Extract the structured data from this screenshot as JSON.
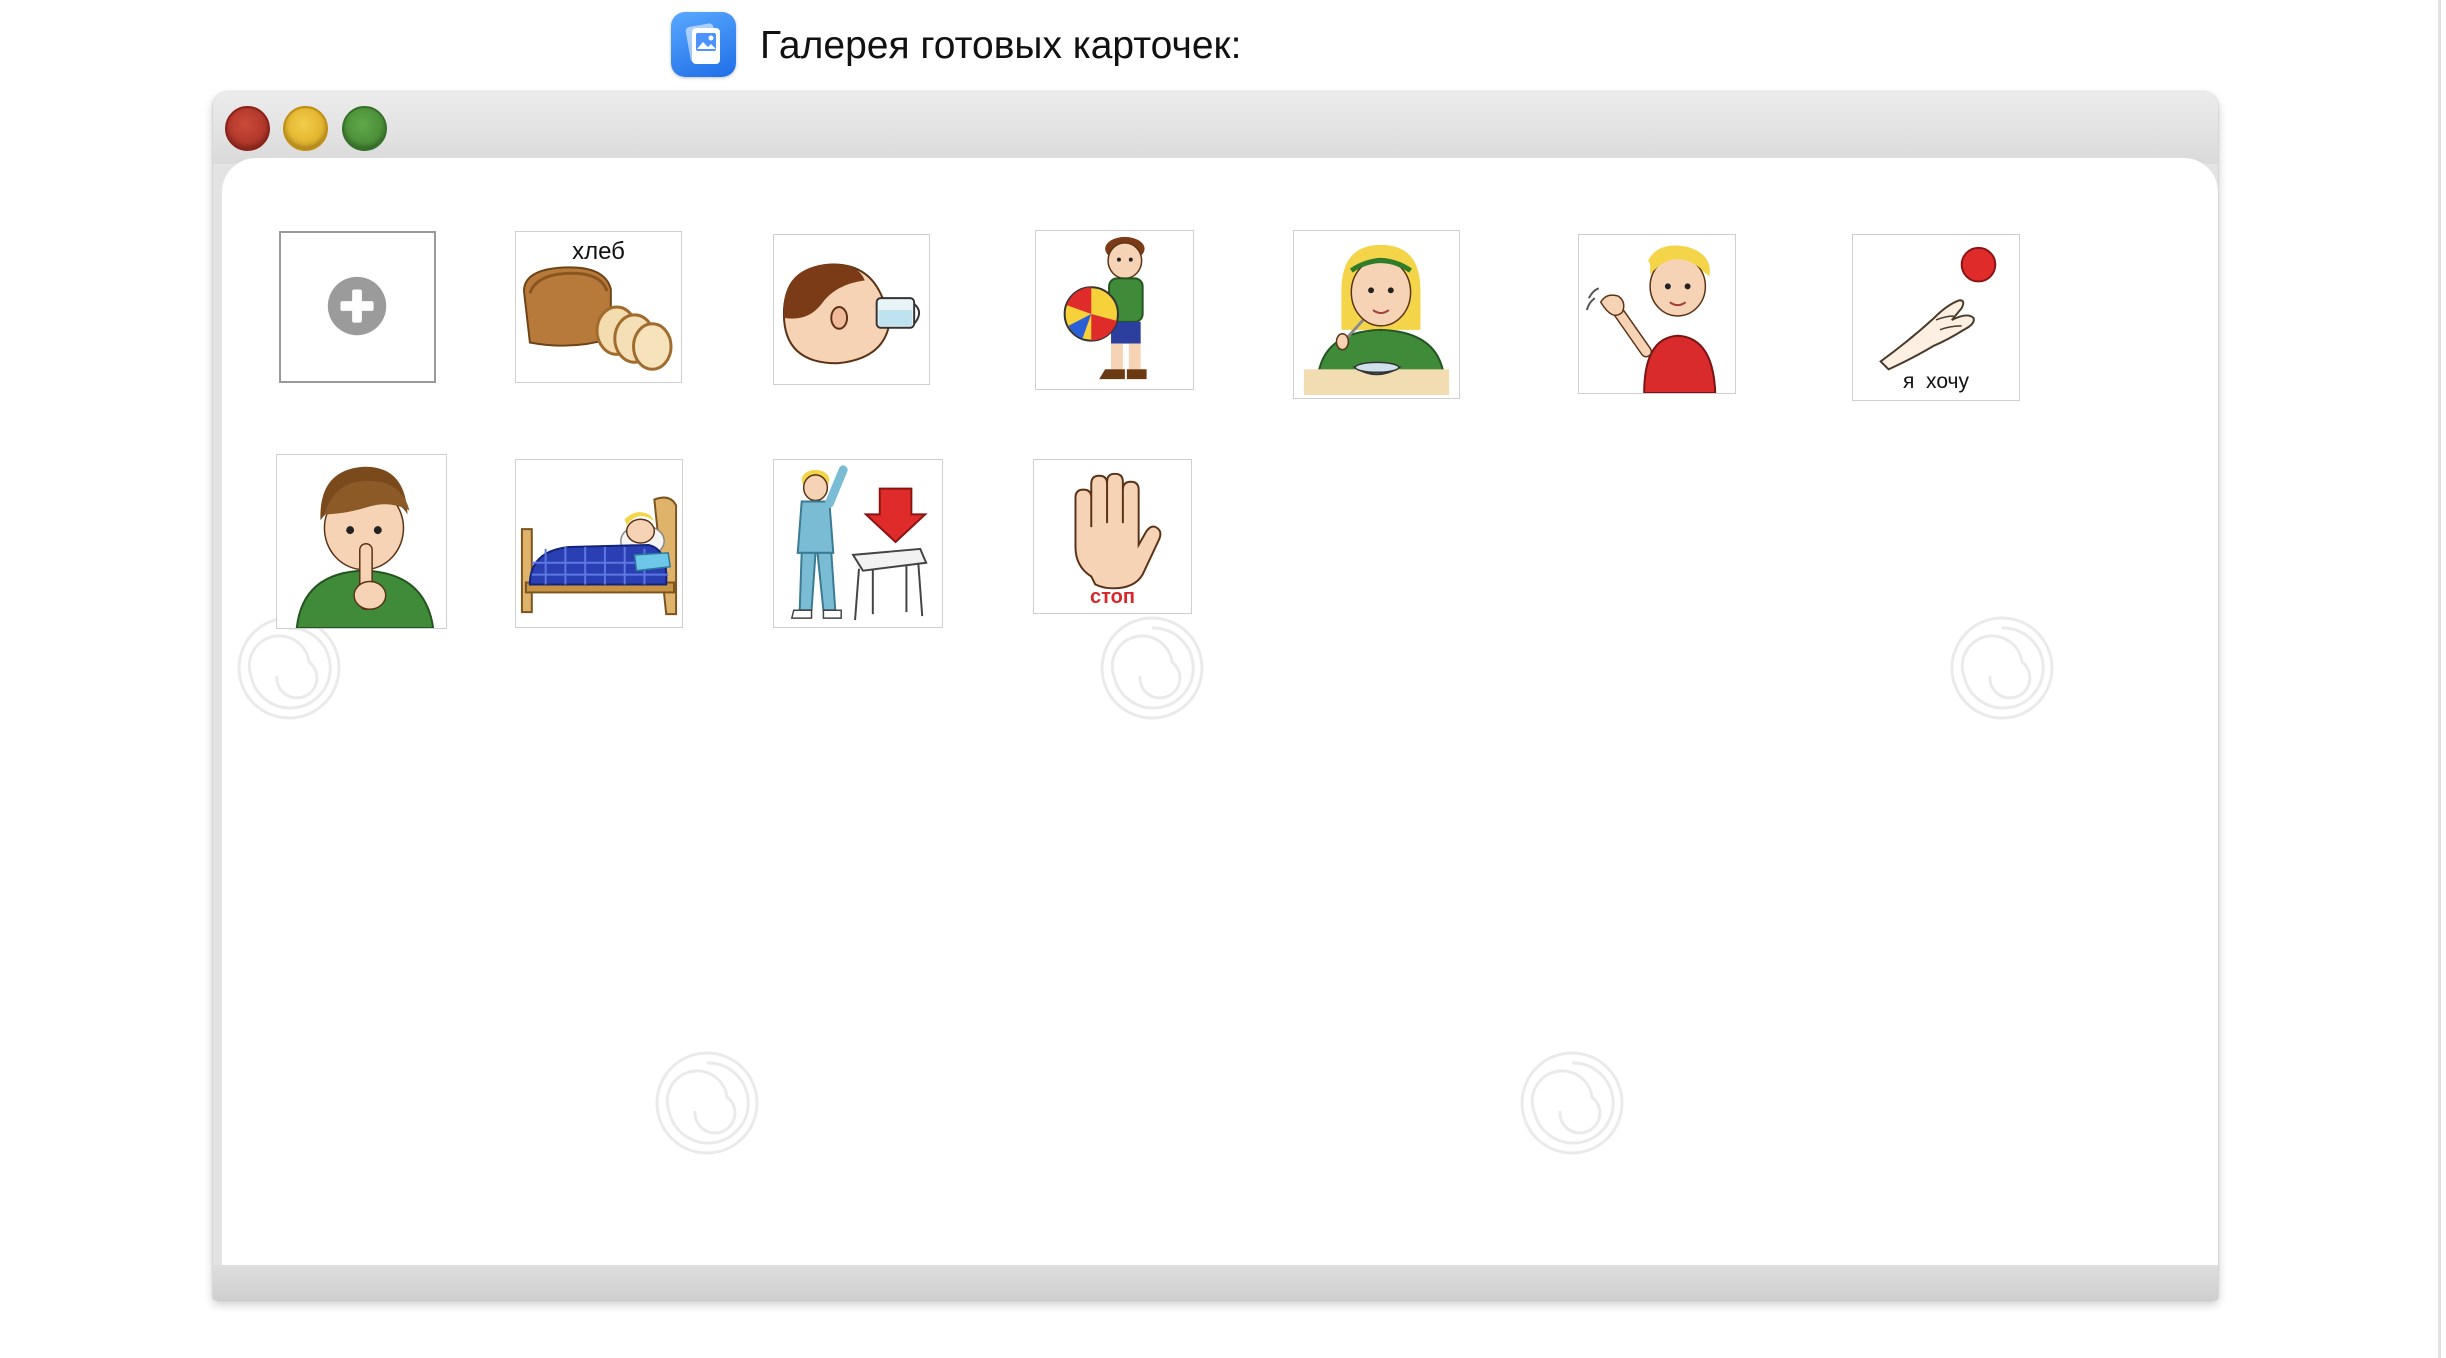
{
  "header": {
    "title": "Галерея готовых карточек:",
    "icon": "gallery-app-icon"
  },
  "window": {
    "controls": [
      "close",
      "minimize",
      "maximize"
    ],
    "colors": {
      "close": "#b83a2c",
      "minimize": "#e9b931",
      "maximize": "#4f9540"
    }
  },
  "gallery": {
    "add_card": {
      "icon": "plus-circle-icon"
    },
    "cards": [
      {
        "id": "bread",
        "label": "хлеб",
        "icon": "bread-icon"
      },
      {
        "id": "drink",
        "label": "",
        "icon": "boy-drinking-icon"
      },
      {
        "id": "play-ball",
        "label": "",
        "icon": "boy-with-ball-icon"
      },
      {
        "id": "eat",
        "label": "",
        "icon": "girl-eating-icon"
      },
      {
        "id": "hello",
        "label": "",
        "icon": "boy-waving-icon"
      },
      {
        "id": "i-want",
        "label": "я  хочу",
        "icon": "hand-reaching-icon"
      },
      {
        "id": "quiet",
        "label": "",
        "icon": "boy-shush-icon"
      },
      {
        "id": "sleep",
        "label": "",
        "icon": "child-sleeping-icon"
      },
      {
        "id": "dress",
        "label": "",
        "icon": "boy-dressing-icon"
      },
      {
        "id": "stop",
        "label": "стоп",
        "icon": "stop-hand-icon"
      }
    ]
  }
}
